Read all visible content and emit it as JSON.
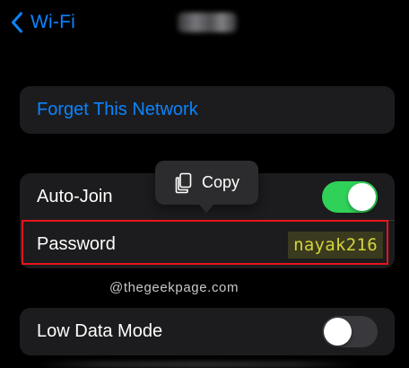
{
  "nav": {
    "back_label": "Wi-Fi",
    "back_icon": "chevron-left-icon",
    "title_blurred": true
  },
  "forget": {
    "label": "Forget This Network"
  },
  "settings": {
    "auto_join": {
      "label": "Auto-Join",
      "enabled": true
    },
    "password": {
      "label": "Password",
      "value": "nayak216"
    },
    "low_data_mode": {
      "label": "Low Data Mode",
      "enabled": false
    }
  },
  "context_menu": {
    "label": "Copy",
    "icon": "copy-icon"
  },
  "watermark": "@thegeekpage.com",
  "colors": {
    "background": "#000000",
    "card": "#1c1c1e",
    "accent_blue": "#0a84ff",
    "toggle_on": "#30d158",
    "toggle_off": "#39393d",
    "highlight_border": "#e8141b",
    "password_text": "#d4d43a"
  }
}
